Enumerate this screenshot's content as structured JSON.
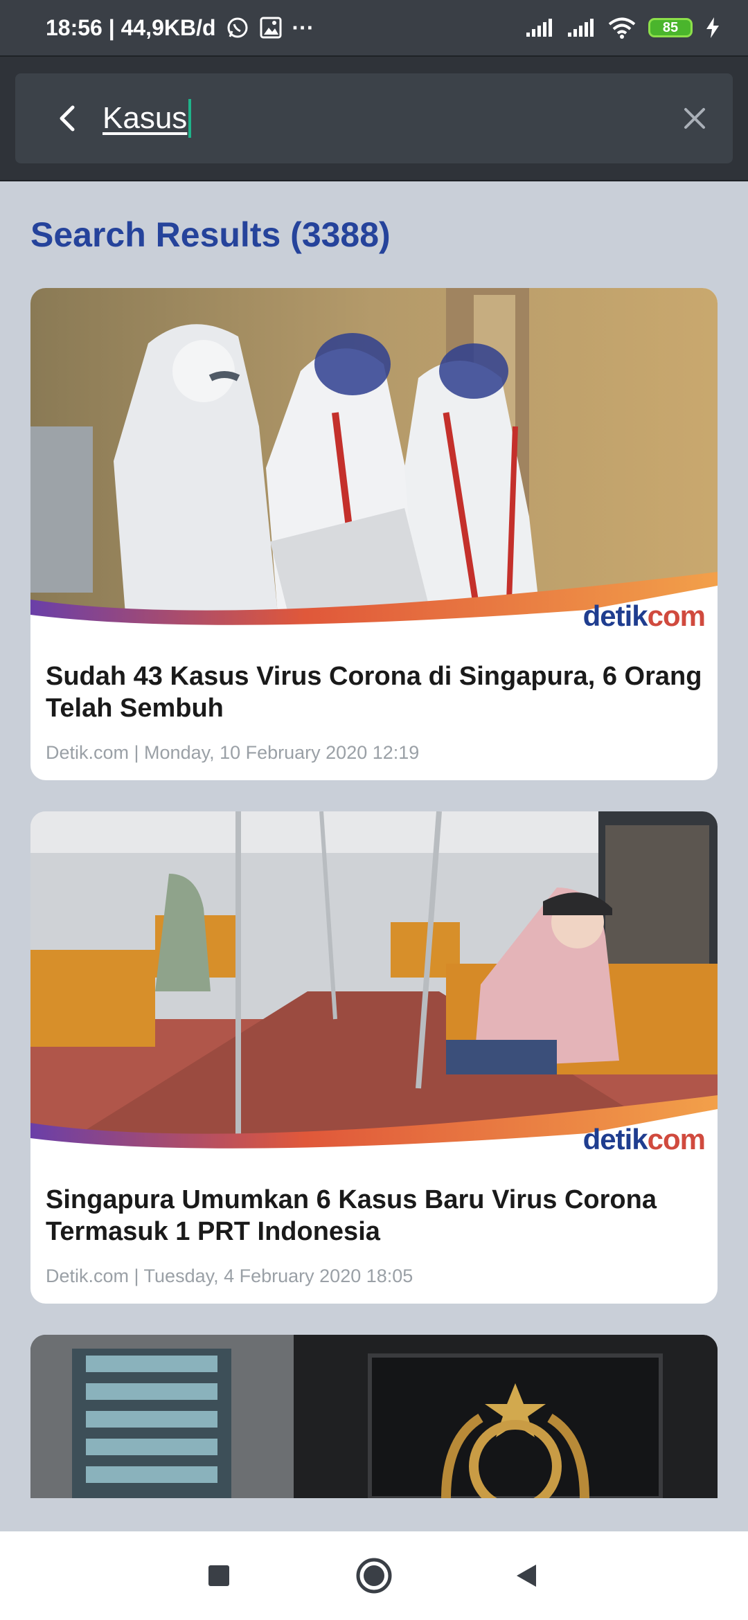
{
  "status_bar": {
    "time_speed": "18:56 | 44,9KB/d",
    "dots": "···",
    "battery": "85"
  },
  "search": {
    "value": "Kasus",
    "placeholder": ""
  },
  "results": {
    "title": "Search Results (3388)"
  },
  "articles": [
    {
      "title": "Sudah 43 Kasus Virus Corona di Singapura, 6 Orang Telah Sembuh",
      "meta": "Detik.com | Monday, 10 February 2020 12:19",
      "logo_main": "detik",
      "logo_accent": "com"
    },
    {
      "title": "Singapura Umumkan 6 Kasus Baru Virus Corona Termasuk 1 PRT Indonesia",
      "meta": "Detik.com | Tuesday, 4 February 2020 18:05",
      "logo_main": "detik",
      "logo_accent": "com"
    }
  ],
  "colors": {
    "accent_blue": "#25439b",
    "background": "#c9cfd8",
    "topbar": "#2f3339",
    "caret": "#1fb38a"
  },
  "icons": {
    "back": "chevron-left-icon",
    "clear": "close-icon",
    "nav_recent": "square-icon",
    "nav_home": "circle-icon",
    "nav_back": "triangle-back-icon"
  }
}
